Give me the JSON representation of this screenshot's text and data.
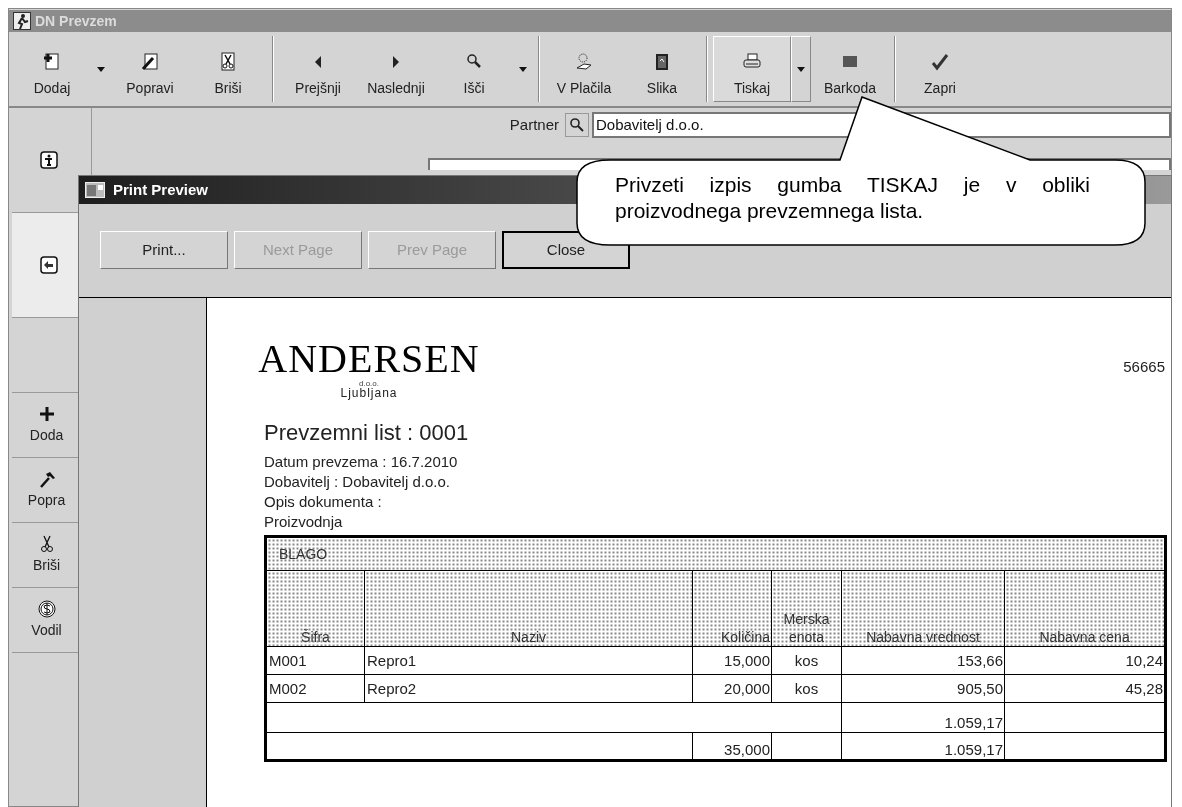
{
  "window": {
    "title": "DN Prevzem"
  },
  "toolbar": [
    [
      {
        "label": "Dodaj",
        "dropdown": true,
        "hot": false
      },
      {
        "label": "Popravi",
        "dropdown": false,
        "hot": false
      },
      {
        "label": "Briši",
        "dropdown": false,
        "hot": false
      }
    ],
    [
      {
        "label": "Prejšnji",
        "dropdown": false,
        "hot": false
      },
      {
        "label": "Naslednji",
        "dropdown": false,
        "hot": false
      },
      {
        "label": "Išči",
        "dropdown": true,
        "hot": false
      }
    ],
    [
      {
        "label": "V Plačila",
        "dropdown": false,
        "hot": false
      },
      {
        "label": "Slika",
        "dropdown": false,
        "hot": false
      }
    ],
    [
      {
        "label": "Tiskaj",
        "dropdown": true,
        "hot": true
      },
      {
        "label": "Barkoda",
        "dropdown": false,
        "hot": false
      }
    ],
    [
      {
        "label": "Zapri",
        "dropdown": false,
        "hot": false
      }
    ]
  ],
  "side_panel": [
    {
      "kind": "tab",
      "selected": false
    },
    {
      "kind": "tab",
      "selected": true
    },
    {
      "kind": "blank"
    },
    {
      "kind": "button",
      "label": "Doda"
    },
    {
      "kind": "button",
      "label": "Popra"
    },
    {
      "kind": "button",
      "label": "Briši"
    },
    {
      "kind": "button",
      "label": "Vodil"
    }
  ],
  "form": {
    "partner_label": "Partner",
    "partner_value": "Dobavitelj d.o.o."
  },
  "print_preview": {
    "title": "Print Preview",
    "buttons": [
      {
        "label": "Print...",
        "disabled": false,
        "default": false
      },
      {
        "label": "Next Page",
        "disabled": true,
        "default": false
      },
      {
        "label": "Prev Page",
        "disabled": true,
        "default": false
      },
      {
        "label": "Close",
        "disabled": false,
        "default": true
      }
    ],
    "page": {
      "logo": "ANDERSEN",
      "logo_sub": "d.o.o.",
      "city": "Ljubljana",
      "number": "56665",
      "heading": "Prevzemni list : 0001",
      "lines": [
        "Datum prevzema : 16.7.2010",
        "Dobavitelj : Dobavitelj d.o.o.",
        "Opis dokumenta :",
        "Proizvodnja"
      ],
      "table": {
        "section": "BLAGO",
        "columns": [
          "Šifra",
          "Naziv",
          "Količina",
          "Merska enota",
          "Nabavna vrednost",
          "Nabavna cena"
        ],
        "rows": [
          [
            "M001",
            "Repro1",
            "15,000",
            "kos",
            "153,66",
            "10,24"
          ],
          [
            "M002",
            "Repro2",
            "20,000",
            "kos",
            "905,50",
            "45,28"
          ]
        ],
        "totals": [
          {
            "kind": "subtotal",
            "value": "1.059,17"
          },
          {
            "kind": "total",
            "quantity": "35,000",
            "value": "1.059,17"
          }
        ]
      }
    }
  },
  "callout": {
    "text": "Privzeti izpis gumba TISKAJ je v obliki proizvodnega prevzemnega lista."
  }
}
